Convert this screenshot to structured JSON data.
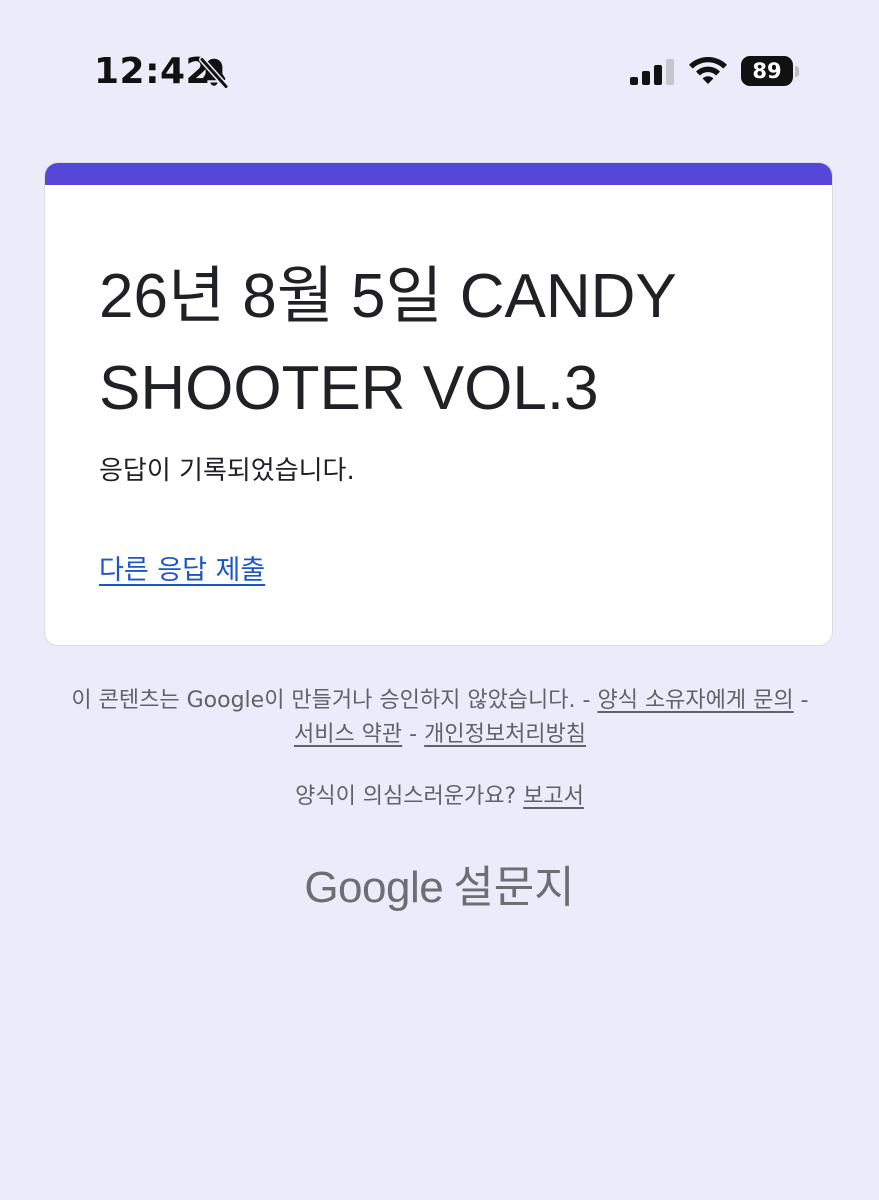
{
  "status_bar": {
    "time": "12:42",
    "battery": "89",
    "icons": [
      "bell-slash-icon",
      "cellular-signal-icon",
      "wifi-icon",
      "battery-icon"
    ]
  },
  "form": {
    "accent_color": "#5548d9",
    "title": "26년 8월 5일 CANDY SHOOTER VOL.3",
    "confirmation": "응답이 기록되었습니다.",
    "resubmit_link": "다른 응답 제출"
  },
  "footer": {
    "disclaimer_text": "이 콘텐츠는 Google이 만들거나 승인하지 않았습니다.",
    "sep1": " - ",
    "contact_owner_link": "양식 소유자에게 문의",
    "sep2": " - ",
    "terms_link": "서비스 약관",
    "sep3": " - ",
    "privacy_link": "개인정보처리방침",
    "report_question": "양식이 의심스러운가요?",
    "report_link": "보고서",
    "brand_google": "Google",
    "brand_product": "설문지"
  }
}
